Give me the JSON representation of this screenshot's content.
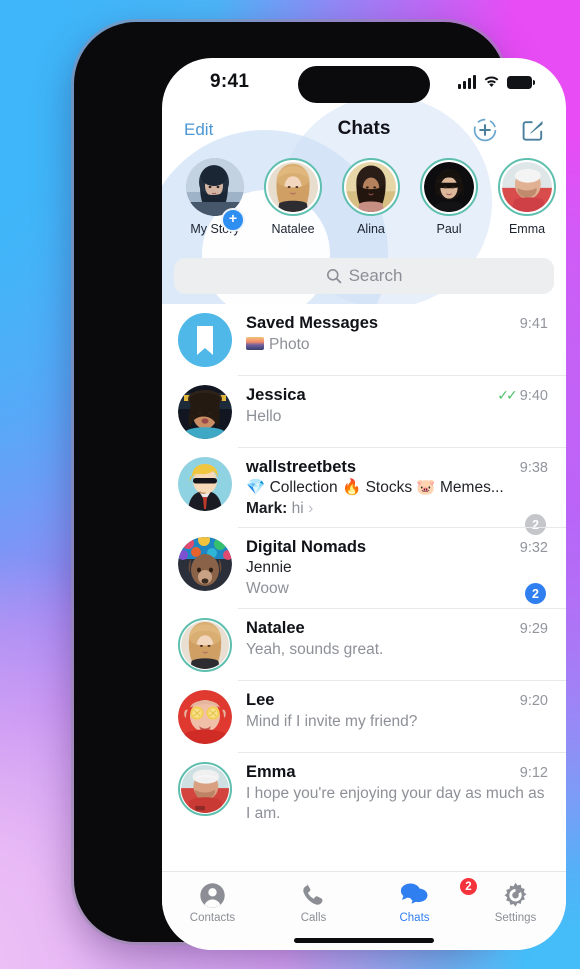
{
  "status_bar": {
    "time": "9:41",
    "signal_icon": "cellular-bars-icon",
    "wifi_icon": "wifi-icon",
    "battery_icon": "battery-icon"
  },
  "nav_bar": {
    "edit_label": "Edit",
    "title": "Chats",
    "add_contact_icon": "add-contact-icon",
    "compose_icon": "compose-icon"
  },
  "stories": [
    {
      "name": "My Story",
      "type": "own",
      "add_badge": "+"
    },
    {
      "name": "Natalee",
      "type": "unseen"
    },
    {
      "name": "Alina",
      "type": "unseen"
    },
    {
      "name": "Paul",
      "type": "unseen"
    },
    {
      "name": "Emma",
      "type": "unseen"
    }
  ],
  "search": {
    "placeholder": "Search",
    "icon": "search-icon"
  },
  "chats": [
    {
      "name": "Saved Messages",
      "time": "9:41",
      "preview": "Photo",
      "has_photo_chip": true,
      "avatar": "saved-messages-bookmark",
      "badge": "",
      "badge_style": "none",
      "read_ticks": false,
      "ring": false
    },
    {
      "name": "Jessica",
      "time": "9:40",
      "preview": "Hello",
      "has_photo_chip": false,
      "avatar": "photo-jessica",
      "badge": "",
      "badge_style": "none",
      "read_ticks": true,
      "ring": false
    },
    {
      "name": "wallstreetbets",
      "time": "9:38",
      "preview": "💎 Collection 🔥 Stocks 🐷 Memes...",
      "sender_line": "Mark:",
      "sender_msg": "hi",
      "has_photo_chip": false,
      "avatar": "photo-wallstreetbets",
      "badge": "2",
      "badge_style": "muted",
      "read_ticks": false,
      "ring": false
    },
    {
      "name": "Digital Nomads",
      "time": "9:32",
      "preview": "Jennie",
      "second_line": "Woow",
      "has_photo_chip": false,
      "avatar": "photo-digital-nomads",
      "badge": "2",
      "badge_style": "active",
      "read_ticks": false,
      "ring": false
    },
    {
      "name": "Natalee",
      "time": "9:29",
      "preview": "Yeah, sounds great.",
      "has_photo_chip": false,
      "avatar": "photo-natalee",
      "badge": "",
      "badge_style": "none",
      "read_ticks": false,
      "ring": true
    },
    {
      "name": "Lee",
      "time": "9:20",
      "preview": "Mind if I invite my friend?",
      "has_photo_chip": false,
      "avatar": "photo-lee",
      "badge": "",
      "badge_style": "none",
      "read_ticks": false,
      "ring": false
    },
    {
      "name": "Emma",
      "time": "9:12",
      "preview": "I hope you're enjoying your day as much as I am.",
      "has_photo_chip": false,
      "avatar": "photo-emma",
      "badge": "",
      "badge_style": "none",
      "read_ticks": false,
      "ring": true
    }
  ],
  "tab_bar": {
    "tabs": [
      {
        "label": "Contacts",
        "icon": "contacts-icon",
        "active": false,
        "badge": ""
      },
      {
        "label": "Calls",
        "icon": "phone-icon",
        "active": false,
        "badge": ""
      },
      {
        "label": "Chats",
        "icon": "chats-icon",
        "active": true,
        "badge": "2"
      },
      {
        "label": "Settings",
        "icon": "gear-icon",
        "active": false,
        "badge": ""
      }
    ]
  },
  "colors": {
    "accent_blue": "#2f7ff0",
    "link_blue": "#4b96d4",
    "story_ring_green": "#5fbfae",
    "badge_red": "#f4333d",
    "badge_muted": "#c4c6ca",
    "read_tick_green": "#4cc26a",
    "saved_messages_blue": "#4fb8e8"
  }
}
